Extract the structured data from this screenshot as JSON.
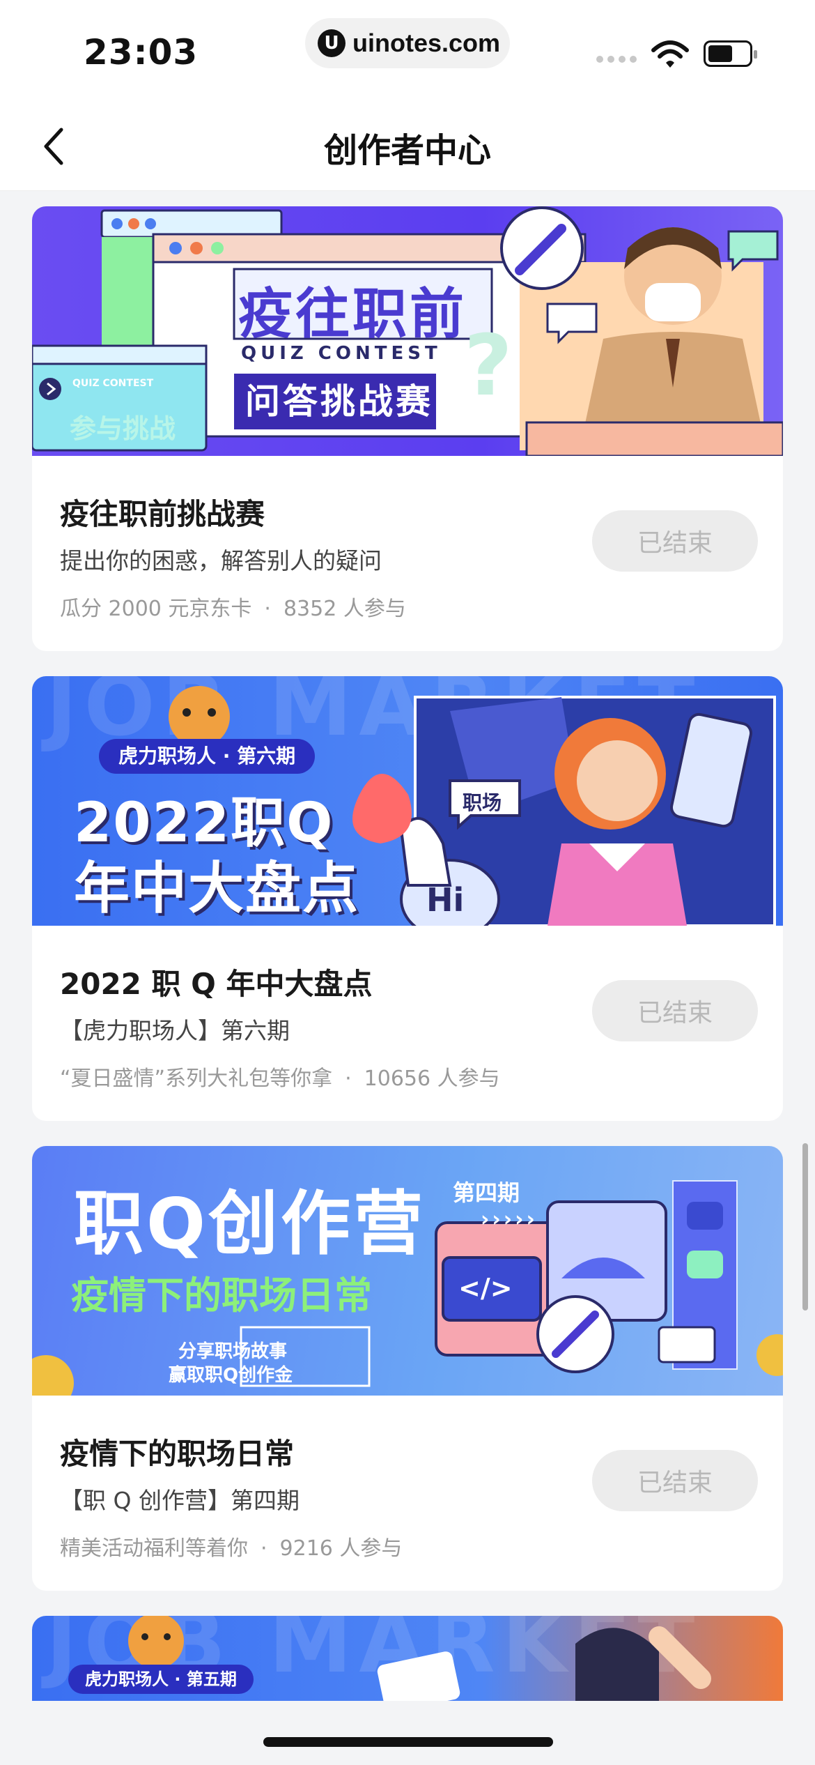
{
  "status_bar": {
    "time": "23:03",
    "url": "uinotes.com",
    "url_icon": "U"
  },
  "header": {
    "title": "创作者中心"
  },
  "cards": [
    {
      "title": "疫往职前挑战赛",
      "subtitle": "提出你的困惑，解答别人的疑问",
      "reward": "瓜分 2000 元京东卡",
      "participants": "8352 人参与",
      "status": "已结束",
      "banner": {
        "main": "疫往职前",
        "en": "QUIZ CONTEST",
        "sub": "问答挑战赛",
        "side": "参与挑战",
        "mini_en": "QUIZ CONTEST"
      }
    },
    {
      "title": "2022 职 Q 年中大盘点",
      "subtitle": "【虎力职场人】第六期",
      "reward": "“夏日盛情”系列大礼包等你拿",
      "participants": "10656 人参与",
      "status": "已结束",
      "banner": {
        "tag": "虎力职场人 · 第六期",
        "line1": "2022职Q",
        "line2": "年中大盘点",
        "bubble": "职场",
        "hi": "Hi",
        "bg_text": "JOB MARKET"
      }
    },
    {
      "title": "疫情下的职场日常",
      "subtitle": "【职 Q 创作营】第四期",
      "reward": "精美活动福利等着你",
      "participants": "9216 人参与",
      "status": "已结束",
      "banner": {
        "main": "职Q创作营",
        "issue": "第四期",
        "arrows": "›››››",
        "sub": "疫情下的职场日常",
        "cta1": "分享职场故事",
        "cta2": "赢取职Q创作金",
        "code": "</>"
      }
    }
  ],
  "partial_card": {
    "tag": "虎力职场人 · 第五期",
    "bg_text": "JOB MARKET"
  },
  "colors": {
    "accent_purple": "#5b3ef0",
    "accent_blue": "#3a6ff2",
    "button_bg": "#ececec"
  }
}
